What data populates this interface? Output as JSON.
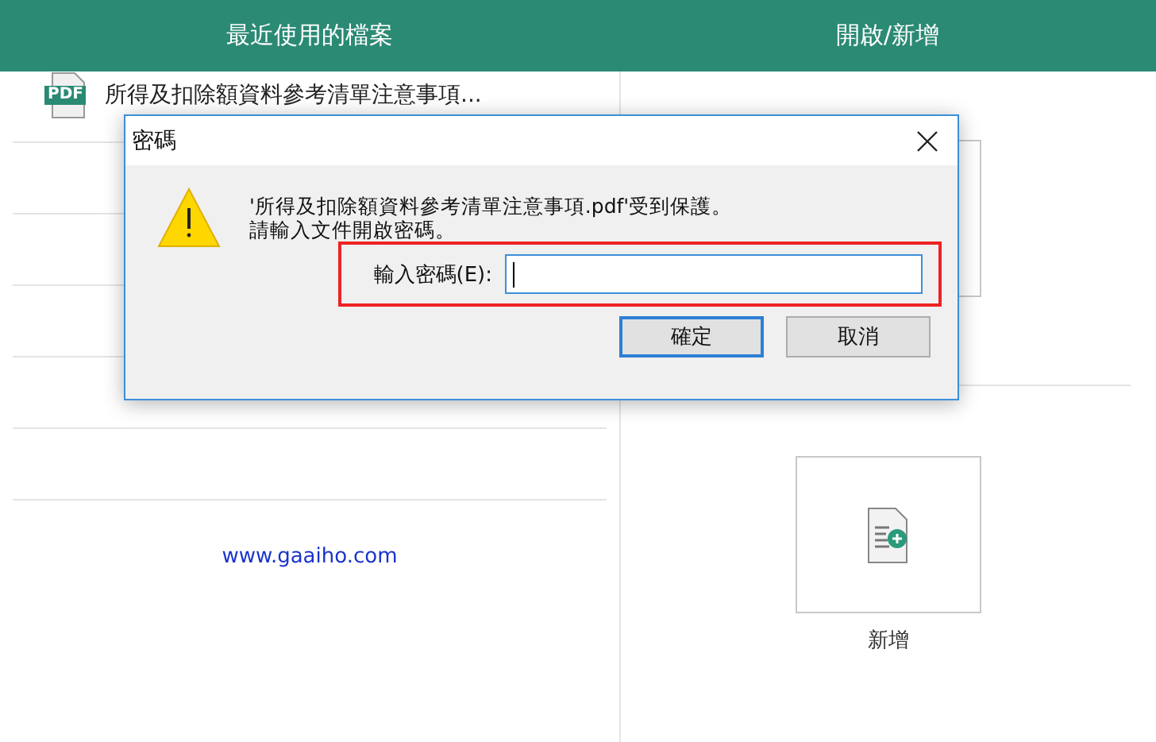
{
  "header": {
    "recent_title": "最近使用的檔案",
    "open_new_title": "開啟/新增"
  },
  "recent_files": [
    {
      "badge": "PDF",
      "name": "所得及扣除額資料參考清單注意事項..."
    }
  ],
  "website_link": "www.gaaiho.com",
  "new_tile": {
    "label": "新增"
  },
  "dialog": {
    "title": "密碼",
    "message_lines": [
      "'所得及扣除額資料參考清單注意事項.pdf'受到保護。",
      "請輸入文件開啟密碼。"
    ],
    "password_label": "輸入密碼(E):",
    "highlighted": true,
    "buttons": [
      {
        "label": "確定",
        "default": true
      },
      {
        "label": "取消",
        "default": false
      }
    ]
  }
}
